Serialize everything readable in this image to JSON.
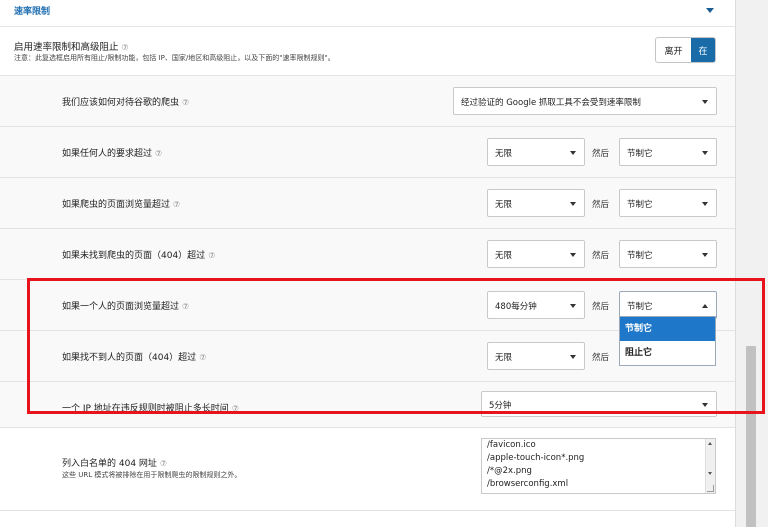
{
  "section": {
    "title": "速率限制"
  },
  "master": {
    "label": "启用速率限制和高级阻止",
    "help": "⑦",
    "note": "注意：此复选框启用所有阻止/限制功能，包括 IP、国家/地区和高级阻止，以及下面的\"速率限制规则\"。",
    "toggle_off": "离开",
    "toggle_on": "在"
  },
  "then_label": "然后",
  "rows": [
    {
      "label": "我们应该如何对待谷歌的爬虫",
      "help": "⑦",
      "select1": "经过验证的 Google 抓取工具不会受到速率限制"
    },
    {
      "label": "如果任何人的要求超过",
      "help": "⑦",
      "select1": "无限",
      "select2": "节制它"
    },
    {
      "label": "如果爬虫的页面浏览量超过",
      "help": "⑦",
      "select1": "无限",
      "select2": "节制它"
    },
    {
      "label": "如果未找到爬虫的页面（404）超过",
      "help": "⑦",
      "select1": "无限",
      "select2": "节制它"
    },
    {
      "label": "如果一个人的页面浏览量超过",
      "help": "⑦",
      "select1": "480每分钟",
      "select2": "节制它"
    },
    {
      "label": "如果找不到人的页面（404）超过",
      "help": "⑦",
      "select1": "无限"
    },
    {
      "label": "一个 IP 地址在违反规则时被阻止多长时间",
      "help": "⑦",
      "select1": "5分钟"
    }
  ],
  "dropdown": {
    "options": [
      "节制它",
      "阻止它"
    ]
  },
  "whitelist": {
    "label": "列入白名单的 404 网址",
    "help": "⑦",
    "note": "这些 URL 模式将被排除在用于限制爬虫的限制规则之外。",
    "lines": [
      "/favicon.ico",
      "/apple-touch-icon*.png",
      "/*@2x.png",
      "/browserconfig.xml"
    ]
  },
  "colors": {
    "accent": "#2271b1",
    "toggle_on": "#1a6ca8",
    "highlight": "#e8141b",
    "option_selected": "#1e77c8"
  }
}
